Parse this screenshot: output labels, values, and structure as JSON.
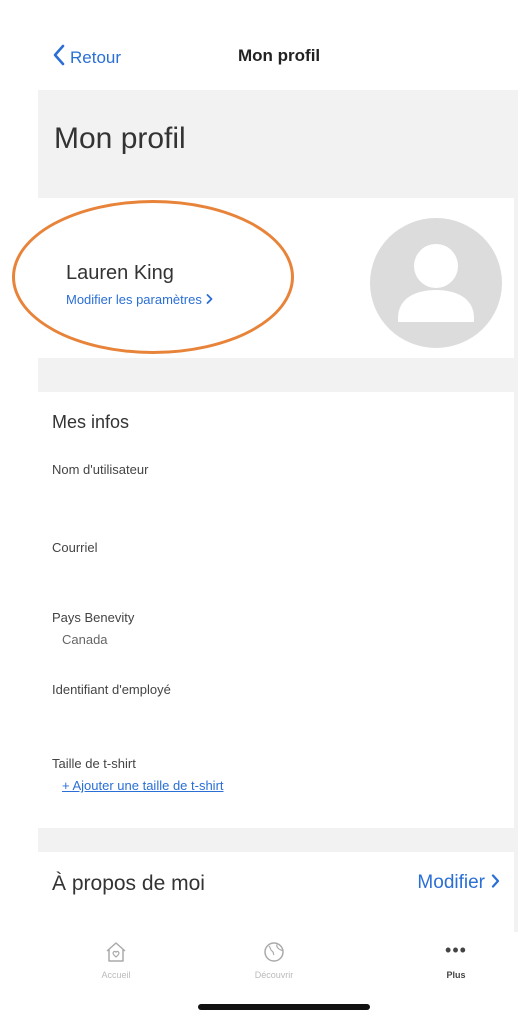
{
  "nav": {
    "back_label": "Retour",
    "title": "Mon profil"
  },
  "page": {
    "title": "Mon profil"
  },
  "profile": {
    "name": "Lauren King",
    "settings_link": "Modifier les paramètres"
  },
  "infos": {
    "title": "Mes infos",
    "fields": [
      {
        "label": "Nom d'utilisateur",
        "value": ""
      },
      {
        "label": "Courriel",
        "value": ""
      },
      {
        "label": "Pays Benevity",
        "value": "Canada"
      },
      {
        "label": "Identifiant d'employé",
        "value": ""
      },
      {
        "label": "Taille de t-shirt",
        "link": "+ Ajouter une taille de t-shirt"
      }
    ]
  },
  "about": {
    "title": "À propos de moi",
    "edit_label": "Modifier"
  },
  "tabbar": {
    "items": [
      {
        "label": "Accueil",
        "icon": "home-icon"
      },
      {
        "label": "Découvrir",
        "icon": "globe-icon"
      },
      {
        "label": "Plus",
        "icon": "more-icon",
        "active": true
      }
    ]
  },
  "colors": {
    "accent": "#2a6fd6",
    "highlight": "#e8833a",
    "page_bg": "#f2f2f2"
  }
}
